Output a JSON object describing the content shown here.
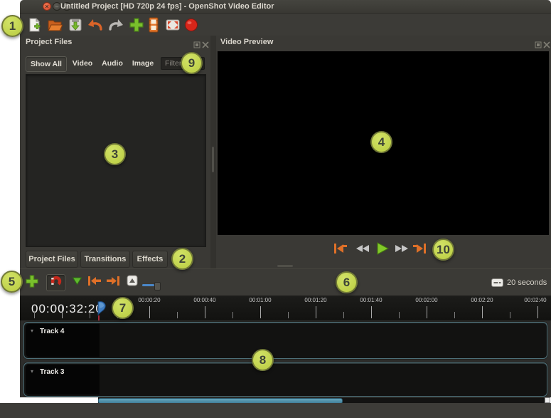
{
  "window": {
    "title": "Untitled Project [HD 720p 24 fps] - OpenShot Video Editor",
    "controls": [
      "close",
      "minimize",
      "maximize"
    ]
  },
  "toolbar": {
    "icons": [
      "new-project",
      "open-project",
      "save-project",
      "undo",
      "redo",
      "import-files",
      "choose-profile",
      "fullscreen",
      "export-video"
    ]
  },
  "project_files": {
    "title": "Project Files",
    "filters": [
      "Show All",
      "Video",
      "Audio",
      "Image"
    ],
    "filter_placeholder": "Filter",
    "tabs": [
      "Project Files",
      "Transitions",
      "Effects"
    ],
    "header_icons": [
      "float",
      "close"
    ]
  },
  "video_preview": {
    "title": "Video Preview",
    "header_icons": [
      "float",
      "close"
    ],
    "transport_icons": [
      "jump-to-start",
      "rewind",
      "play",
      "fast-forward",
      "jump-to-end"
    ]
  },
  "timeline": {
    "toolbar_icons": [
      "add-track",
      "snapping-toggle",
      "razor-tool",
      "previous-marker",
      "next-marker",
      "add-marker",
      "zoom-slider",
      "zoom-scale"
    ],
    "zoom_scale_label": "20 seconds",
    "timecode": "00:00:32:20",
    "ruler_labels": [
      "00:00:20",
      "00:00:40",
      "00:01:00",
      "00:01:20",
      "00:01:40",
      "00:02:00",
      "00:02:20",
      "00:02:40"
    ],
    "tracks": [
      {
        "label": "Track 4"
      },
      {
        "label": "Track 3"
      }
    ]
  },
  "annotations": [
    "1",
    "2",
    "3",
    "4",
    "5",
    "6",
    "7",
    "8",
    "9",
    "10"
  ],
  "colors": {
    "badge": "#c3d551",
    "accent_orange": "#e0702c",
    "play_green": "#79c02c",
    "scrollbar_blue": "#4e93ae",
    "playhead_red": "#a8293a",
    "window_bg": "#3b3a36"
  }
}
